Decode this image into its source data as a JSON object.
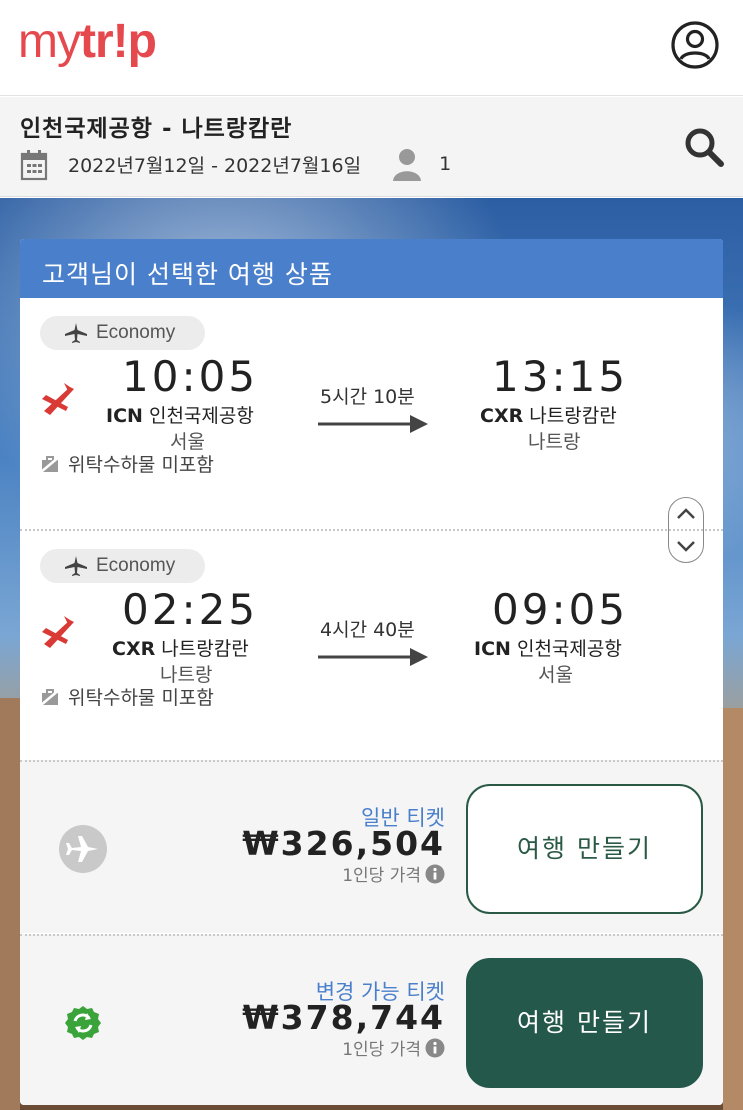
{
  "header": {
    "logo": {
      "text_my": "my",
      "text_trip": "tr!p"
    },
    "profile_icon": "user-circle-icon"
  },
  "search": {
    "route": "인천국제공항 - 나트랑캄란",
    "dates": "2022년7월12일 - 2022년7월16일",
    "passengers": "1",
    "calendar_icon": "calendar-icon",
    "person_icon": "person-icon",
    "search_icon": "search-icon"
  },
  "card": {
    "title": "고객님이 선택한 여행 상품",
    "legs": [
      {
        "cabin": "Economy",
        "dep_time": "10:05",
        "dep_code": "ICN",
        "dep_airport": "인천국제공항",
        "dep_city": "서울",
        "duration": "5시간 10분",
        "arr_time": "13:15",
        "arr_code": "CXR",
        "arr_airport": "나트랑캄란",
        "arr_city": "나트랑",
        "baggage": "위탁수하물 미포함"
      },
      {
        "cabin": "Economy",
        "dep_time": "02:25",
        "dep_code": "CXR",
        "dep_airport": "나트랑캄란",
        "dep_city": "나트랑",
        "duration": "4시간 40분",
        "arr_time": "09:05",
        "arr_code": "ICN",
        "arr_airport": "인천국제공항",
        "arr_city": "서울",
        "baggage": "위탁수하물 미포함"
      }
    ],
    "fares": [
      {
        "name": "일반 티켓",
        "price": "₩326,504",
        "per_person": "1인당 가격",
        "button": "여행 만들기",
        "icon": "airplane-circle-icon"
      },
      {
        "name": "변경 가능 티켓",
        "price": "₩378,744",
        "per_person": "1인당 가격",
        "button": "여행 만들기",
        "icon": "refresh-badge-icon"
      }
    ]
  },
  "colors": {
    "brand": "#e5484d",
    "header_blue": "#4a7fcb",
    "cta_green": "#24584a",
    "airline_red": "#d93a35",
    "flex_green": "#3aa33a"
  }
}
